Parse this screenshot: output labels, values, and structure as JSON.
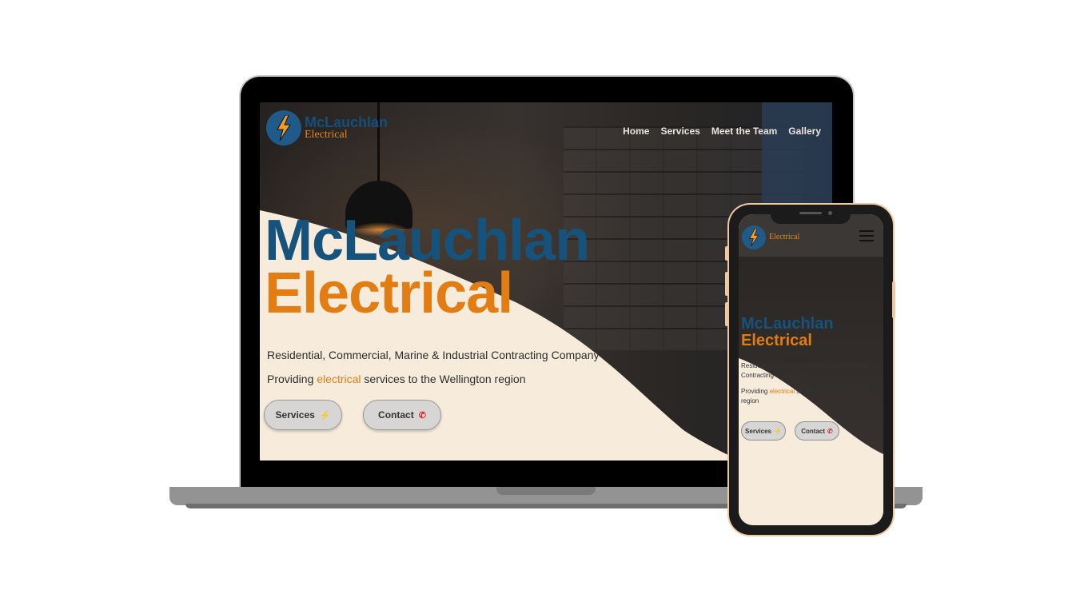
{
  "brand": {
    "name_top": "McLauchlan",
    "name_bottom": "Electrical",
    "colors": {
      "blue": "#15537d",
      "orange": "#e17d12",
      "cream": "#f7ecdc"
    }
  },
  "nav": {
    "items": [
      {
        "label": "Home"
      },
      {
        "label": "Services"
      },
      {
        "label": "Meet the Team"
      },
      {
        "label": "Gallery"
      }
    ]
  },
  "hero": {
    "title_line1": "McLauchlan",
    "title_line2": "Electrical",
    "tagline": "Residential, Commercial, Marine & Industrial Contracting Company",
    "sub_prefix": "Providing",
    "sub_accent": "electrical",
    "sub_suffix": "services to the Wellington region"
  },
  "buttons": {
    "services": {
      "label": "Services",
      "icon": "lightning-icon"
    },
    "contact": {
      "label": "Contact",
      "icon": "phone-icon"
    }
  },
  "mobile": {
    "menu_icon": "hamburger-menu-icon"
  }
}
